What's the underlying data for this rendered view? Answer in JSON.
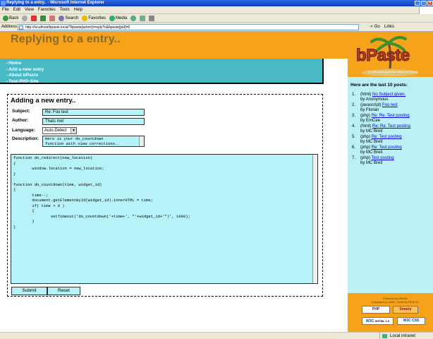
{
  "window": {
    "title": "Replying to a entry.. - Microsoft Internet Explorer"
  },
  "menu": [
    "File",
    "Edit",
    "View",
    "Favorites",
    "Tools",
    "Help"
  ],
  "toolbar": {
    "back": "Back",
    "search": "Search",
    "favorites": "Favorites",
    "media": "Media"
  },
  "address": {
    "label": "Address",
    "url": "http://localhost/bpaste.local/?bpaste[action]=replyTo&bpaste[pid]=6",
    "go": "Go",
    "links": "Links"
  },
  "page": {
    "title": "Replying to a entry..",
    "nav": [
      "Home",
      "Add a new entry",
      "About bPaste",
      "Test-PHP-Site"
    ]
  },
  "logo": {
    "text": "bPaste",
    "tagline": "a code pasting service based on Smarty"
  },
  "form": {
    "title": "Adding a new entry..",
    "subject_label": "Subject:",
    "subject_value": "Re: Foo test",
    "author_label": "Author:",
    "author_value": "Thats me!",
    "language_label": "Language:",
    "language_value": "Auto-Detect",
    "description_label": "Description:",
    "description_value": "Here is your do_countdown\nfunction with view corrections..",
    "code": "function do_redirect(new_location)\n{\n\twindow.location = new_location;\n}\n\nfunction do_countdown(time, widget_id)\n{\n\ttime--;\n\tdocument.getElementById(widget_id).innerHTML = time;\n\tif( time > 0 )\n\t{\n\t\tsetTimeout('do_countdown('+time+', \"'+widget_id+'\")', 1000);\n\t}\n}",
    "submit_label": "Submit",
    "reset_label": "Reset"
  },
  "sidebar": {
    "heading": "Here are the last 10 posts:",
    "by_prefix": "by",
    "posts": [
      {
        "num": "1.",
        "lang": "(html)",
        "title": "No Subject given.",
        "author": "Anonymous"
      },
      {
        "num": "2.",
        "lang": "(javascript)",
        "title": "Foo test",
        "author": "Florian"
      },
      {
        "num": "3.",
        "lang": "(php)",
        "title": "Re: Re: Test posting",
        "author": "EmCee"
      },
      {
        "num": "4.",
        "lang": "(html)",
        "title": "Re: Re: Test posting",
        "author": "MC Breit"
      },
      {
        "num": "5.",
        "lang": "(php)",
        "title": "Re: Test posting",
        "author": "MC Breit"
      },
      {
        "num": "6.",
        "lang": "(php)",
        "title": "Re: Test posting",
        "author": "MC Breit"
      },
      {
        "num": "7.",
        "lang": "(php)",
        "title": "Test posting",
        "author": "MC Breit"
      }
    ]
  },
  "footer": {
    "text": "Powered by bPaste\nCopyright (c) 2005 - 2006 by MCB.CC",
    "badges": [
      "W3C",
      "XHTML 1.0",
      "W3C CSS"
    ]
  },
  "status": {
    "zone": "Local intranet"
  }
}
